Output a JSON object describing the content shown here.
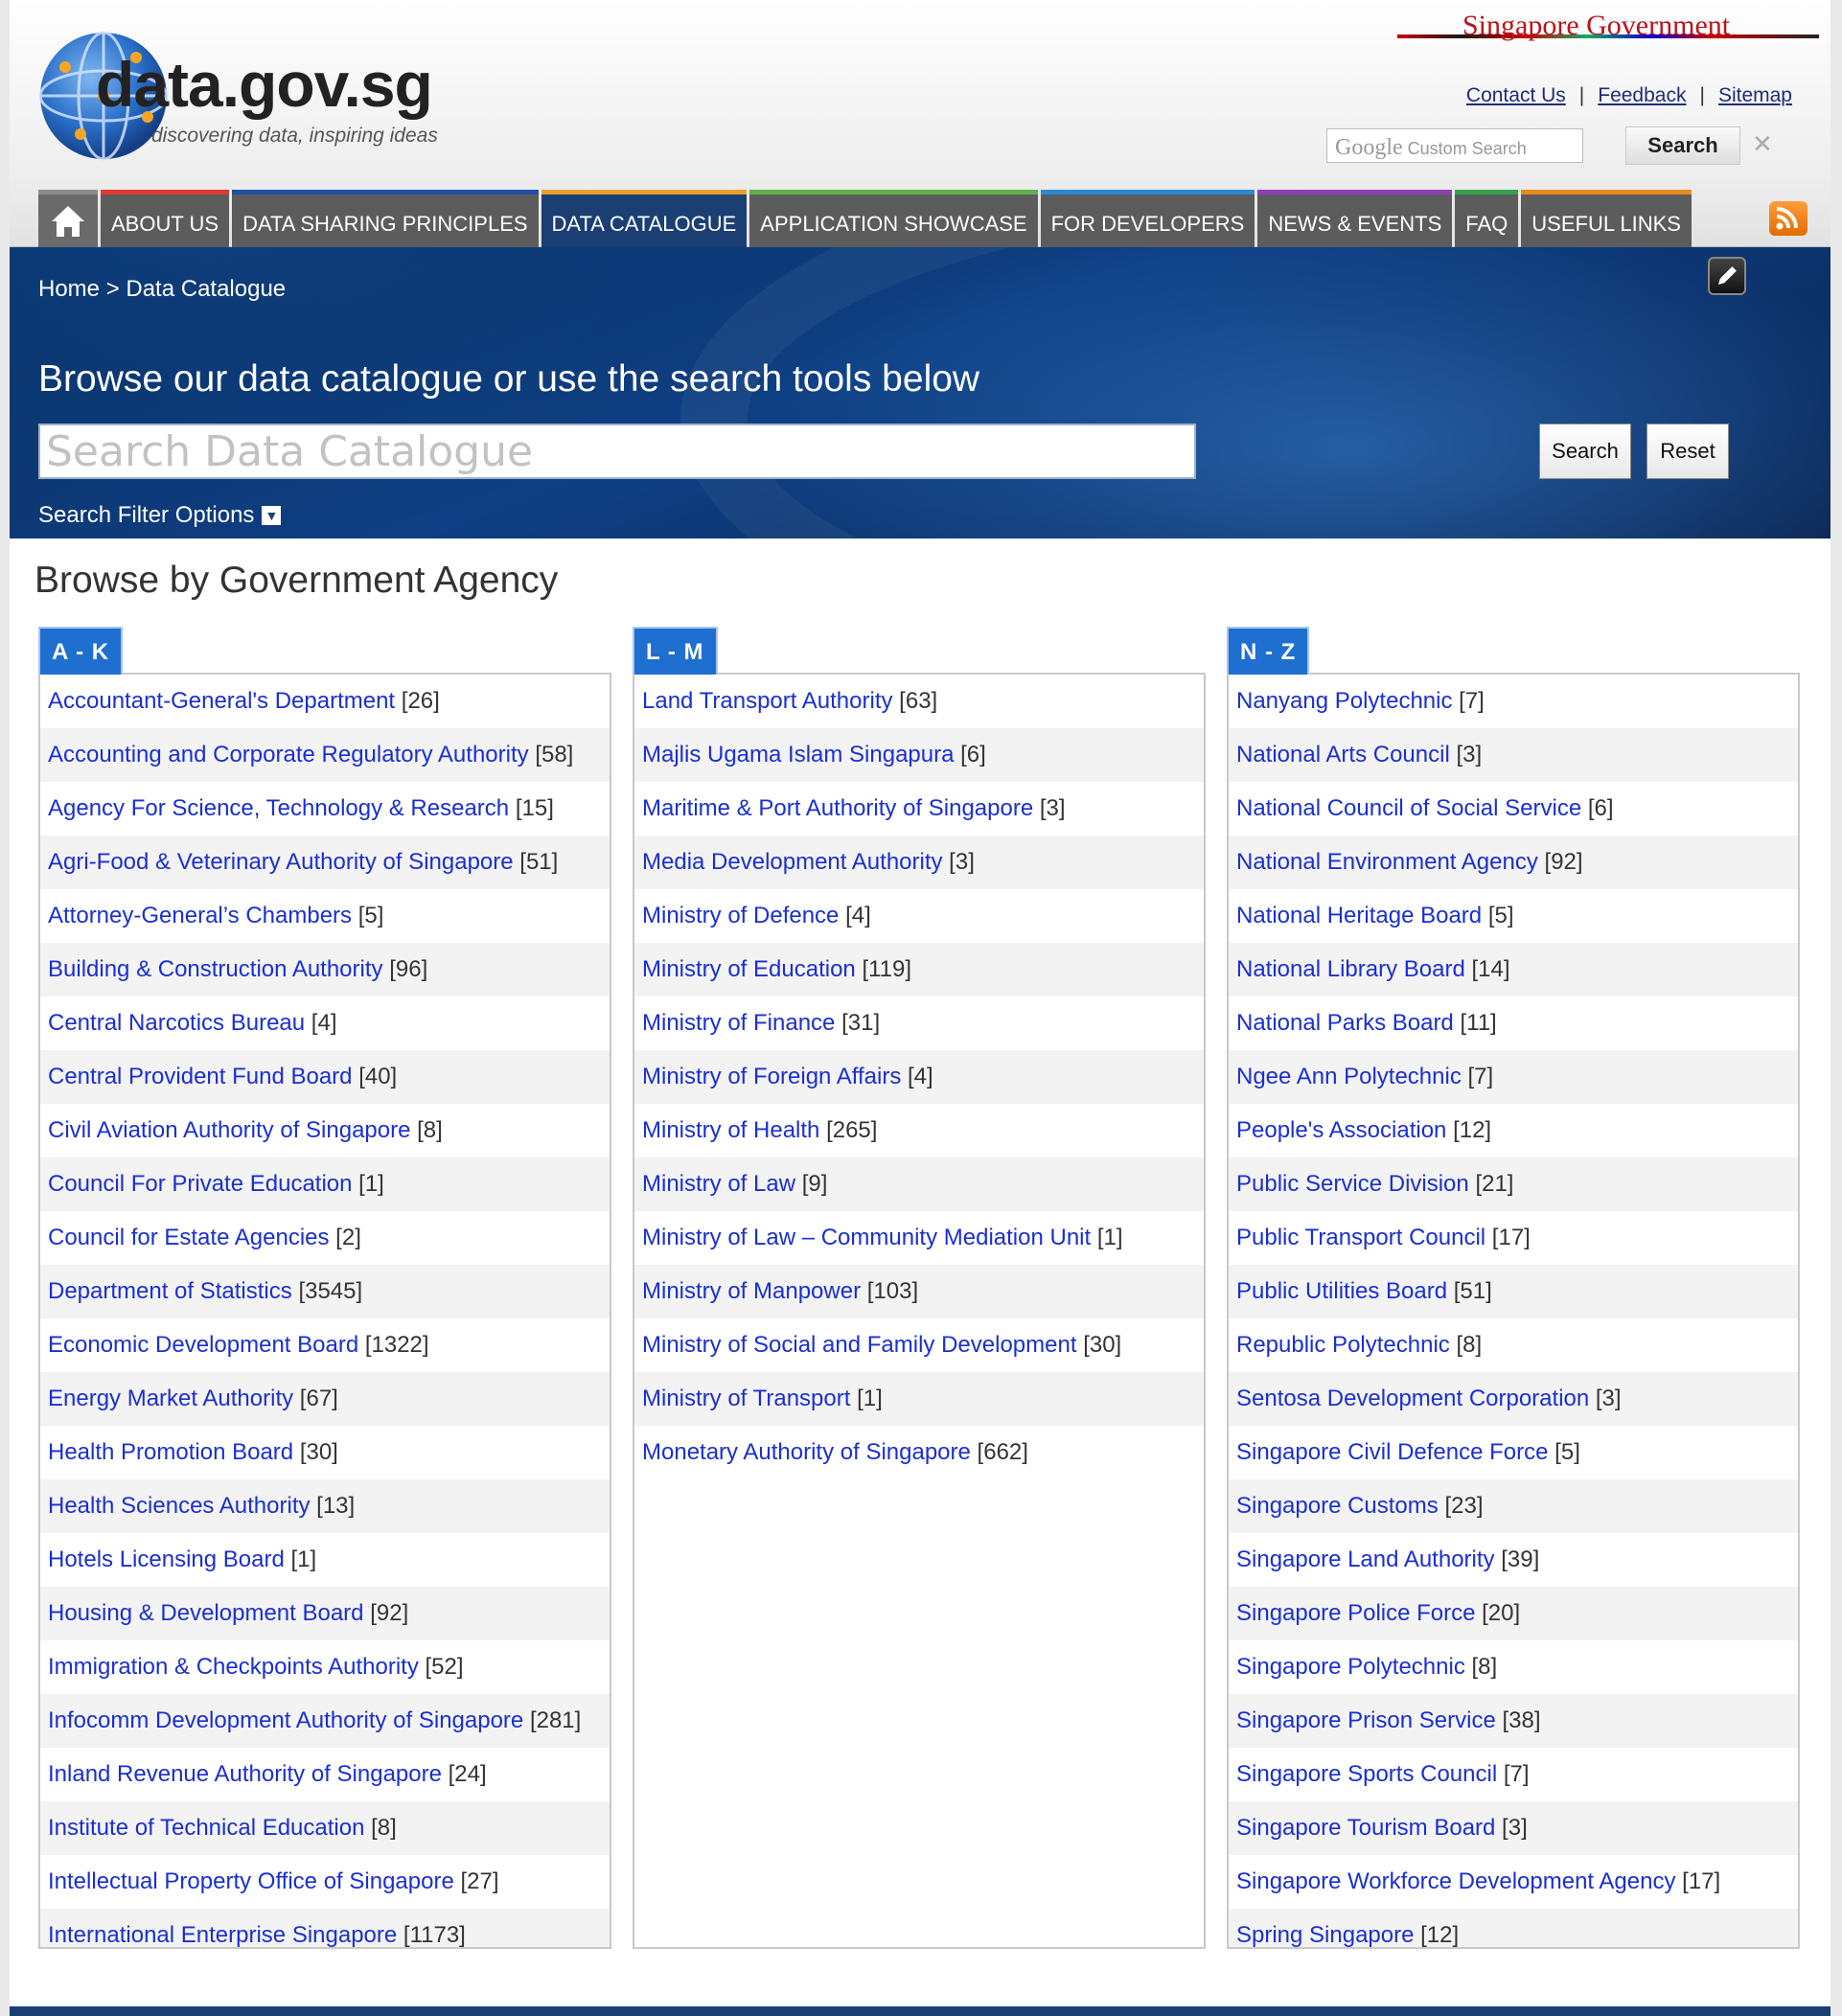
{
  "header": {
    "logo_title": "data.gov.sg",
    "logo_tagline": "discovering data, inspiring ideas",
    "sg_government": "Singapore Government",
    "util_links": [
      "Contact Us",
      "Feedback",
      "Sitemap"
    ],
    "google_placeholder_brand": "Google",
    "google_placeholder_text": "Custom Search",
    "search_button": "Search",
    "clear_glyph": "✕"
  },
  "nav": {
    "items": [
      {
        "label": "ABOUT US",
        "accent": "#e03a2e"
      },
      {
        "label": "DATA SHARING PRINCIPLES",
        "accent": "#1f4fa3"
      },
      {
        "label": "DATA CATALOGUE",
        "accent": "#e9a12b"
      },
      {
        "label": "APPLICATION SHOWCASE",
        "accent": "#5db34a"
      },
      {
        "label": "FOR DEVELOPERS",
        "accent": "#2b8ad6"
      },
      {
        "label": "NEWS & EVENTS",
        "accent": "#8e3fb7"
      },
      {
        "label": "FAQ",
        "accent": "#35a24b"
      },
      {
        "label": "USEFUL LINKS",
        "accent": "#e88b1d"
      }
    ],
    "active_index": 2
  },
  "banner": {
    "breadcrumb": "Home > Data Catalogue",
    "heading": "Browse our data catalogue or use the search tools below",
    "search_placeholder": "Search Data Catalogue",
    "search_button": "Search",
    "reset_button": "Reset",
    "filter_options": "Search Filter Options"
  },
  "main": {
    "title": "Browse by Government Agency",
    "columns": [
      {
        "tab": "A - K",
        "rows": [
          {
            "name": "Accountant-General's Department",
            "count": "[26]"
          },
          {
            "name": "Accounting and Corporate Regulatory Authority",
            "count": "[58]"
          },
          {
            "name": "Agency For Science, Technology & Research",
            "count": "[15]"
          },
          {
            "name": "Agri-Food & Veterinary Authority of Singapore",
            "count": "[51]"
          },
          {
            "name": "Attorney-General’s Chambers",
            "count": "[5]"
          },
          {
            "name": "Building & Construction Authority",
            "count": "[96]"
          },
          {
            "name": "Central Narcotics Bureau",
            "count": "[4]"
          },
          {
            "name": "Central Provident Fund Board",
            "count": "[40]"
          },
          {
            "name": "Civil Aviation Authority of Singapore",
            "count": "[8]"
          },
          {
            "name": "Council For Private Education",
            "count": "[1]"
          },
          {
            "name": "Council for Estate Agencies",
            "count": "[2]"
          },
          {
            "name": "Department of Statistics",
            "count": "[3545]"
          },
          {
            "name": "Economic Development Board",
            "count": "[1322]"
          },
          {
            "name": "Energy Market Authority",
            "count": "[67]"
          },
          {
            "name": "Health Promotion Board",
            "count": "[30]"
          },
          {
            "name": "Health Sciences Authority",
            "count": "[13]"
          },
          {
            "name": "Hotels Licensing Board",
            "count": "[1]"
          },
          {
            "name": "Housing & Development Board",
            "count": "[92]"
          },
          {
            "name": "Immigration & Checkpoints Authority",
            "count": "[52]"
          },
          {
            "name": "Infocomm Development Authority of Singapore",
            "count": "[281]"
          },
          {
            "name": "Inland Revenue Authority of Singapore",
            "count": "[24]"
          },
          {
            "name": "Institute of Technical Education",
            "count": "[8]"
          },
          {
            "name": "Intellectual Property Office of Singapore",
            "count": "[27]"
          },
          {
            "name": "International Enterprise Singapore",
            "count": "[1173]"
          }
        ]
      },
      {
        "tab": "L - M",
        "rows": [
          {
            "name": "Land Transport Authority",
            "count": "[63]"
          },
          {
            "name": "Majlis Ugama Islam Singapura",
            "count": "[6]"
          },
          {
            "name": "Maritime & Port Authority of Singapore",
            "count": "[3]"
          },
          {
            "name": "Media Development Authority",
            "count": "[3]"
          },
          {
            "name": "Ministry of Defence",
            "count": "[4]"
          },
          {
            "name": "Ministry of Education",
            "count": "[119]"
          },
          {
            "name": "Ministry of Finance",
            "count": "[31]"
          },
          {
            "name": "Ministry of Foreign Affairs",
            "count": "[4]"
          },
          {
            "name": "Ministry of Health",
            "count": "[265]"
          },
          {
            "name": "Ministry of Law",
            "count": "[9]"
          },
          {
            "name": "Ministry of Law – Community Mediation Unit",
            "count": "[1]"
          },
          {
            "name": "Ministry of Manpower",
            "count": "[103]"
          },
          {
            "name": "Ministry of Social and Family Development",
            "count": "[30]"
          },
          {
            "name": "Ministry of Transport",
            "count": "[1]"
          },
          {
            "name": "Monetary Authority of Singapore",
            "count": "[662]"
          }
        ]
      },
      {
        "tab": "N - Z",
        "rows": [
          {
            "name": "Nanyang Polytechnic",
            "count": "[7]"
          },
          {
            "name": "National Arts Council",
            "count": "[3]"
          },
          {
            "name": "National Council of Social Service",
            "count": "[6]"
          },
          {
            "name": "National Environment Agency",
            "count": "[92]"
          },
          {
            "name": "National Heritage Board",
            "count": "[5]"
          },
          {
            "name": "National Library Board",
            "count": "[14]"
          },
          {
            "name": "National Parks Board",
            "count": "[11]"
          },
          {
            "name": "Ngee Ann Polytechnic",
            "count": "[7]"
          },
          {
            "name": "People's Association",
            "count": "[12]"
          },
          {
            "name": "Public Service Division",
            "count": "[21]"
          },
          {
            "name": "Public Transport Council",
            "count": "[17]"
          },
          {
            "name": "Public Utilities Board",
            "count": "[51]"
          },
          {
            "name": "Republic Polytechnic",
            "count": "[8]"
          },
          {
            "name": "Sentosa Development Corporation",
            "count": "[3]"
          },
          {
            "name": "Singapore Civil Defence Force",
            "count": "[5]"
          },
          {
            "name": "Singapore Customs",
            "count": "[23]"
          },
          {
            "name": "Singapore Land Authority",
            "count": "[39]"
          },
          {
            "name": "Singapore Police Force",
            "count": "[20]"
          },
          {
            "name": "Singapore Polytechnic",
            "count": "[8]"
          },
          {
            "name": "Singapore Prison Service",
            "count": "[38]"
          },
          {
            "name": "Singapore Sports Council",
            "count": "[7]"
          },
          {
            "name": "Singapore Tourism Board",
            "count": "[3]"
          },
          {
            "name": "Singapore Workforce Development Agency",
            "count": "[17]"
          },
          {
            "name": "Spring Singapore",
            "count": "[12]"
          }
        ]
      }
    ]
  },
  "colors": {
    "link": "#1a2fd1",
    "tab": "#1f6fd1",
    "nav_active": "#1b3f73",
    "banner": "#0e3f84"
  },
  "icons": [
    "globe-logo-icon",
    "home-icon",
    "rss-icon",
    "edit-pencil-icon",
    "chevron-down-icon",
    "close-icon"
  ]
}
